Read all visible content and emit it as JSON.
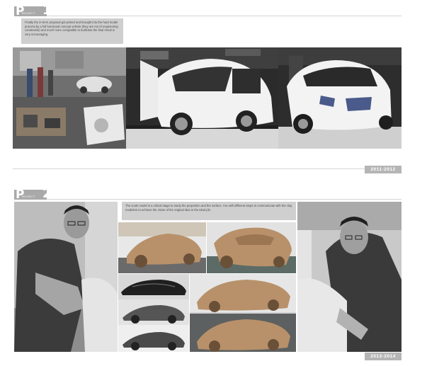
{
  "project1": {
    "letter": "P",
    "word": "ROJECT",
    "number": "1",
    "caption": "Finally the in-term proposal got picked and brought into the hard model process by a full functional concept vehicle (they are not of engineering constraints) and much more compatible to build.But the final result is very encouraging.",
    "years": "2011-2012",
    "photos": [
      "workshop-photo",
      "white-concept-car-doors-open-photo",
      "white-concept-car-front-photo"
    ]
  },
  "project2": {
    "letter": "P",
    "word": "ROJECT",
    "number": "2",
    "caption": "The scale model is a critical stage to study the proportion and the surface. I've with different steps to communicate with the clay modelers to achieve the vision of the original idea in the ideal job.",
    "years": "2013-2014",
    "photos": [
      "designer-portrait-photo",
      "clay-model-front-photo",
      "clay-model-three-quarter-photo",
      "clay-model-side-photo",
      "silver-car-render-photo",
      "clay-model-rear-photo",
      "designer-sculpting-photo"
    ]
  },
  "colors": {
    "tab": "#a9a9a9",
    "caption_bg": "#cfcfcf",
    "clay": "#b8916a"
  }
}
